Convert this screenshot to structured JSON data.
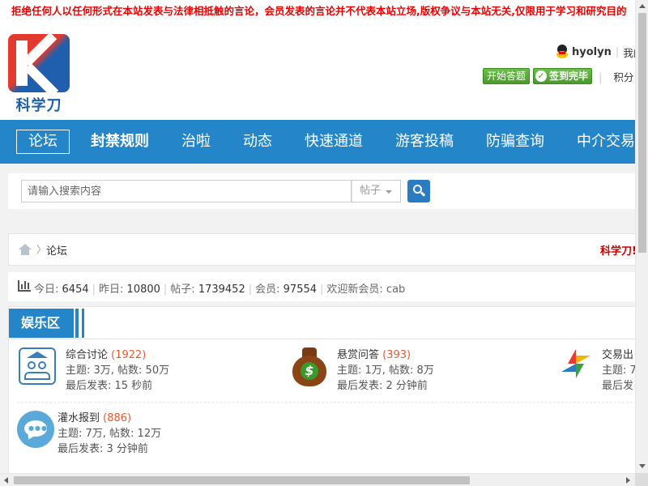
{
  "notice": "拒绝任何人以任何形式在本站发表与法律相抵触的言论，会员发表的言论并不代表本站立场,版权争议与本站无关,仅限用于学习和研究目的",
  "logo": {
    "text": "科学刀"
  },
  "user": {
    "name": "hyolyn",
    "my_link": "我的"
  },
  "header_buttons": {
    "start_quiz": "开始答题",
    "signed_in": "签到完毕",
    "points": "积分"
  },
  "nav": [
    "论坛",
    "封禁规则",
    "治啦",
    "动态",
    "快速通道",
    "游客投稿",
    "防骗查询",
    "中介交易"
  ],
  "search": {
    "placeholder": "请输入搜索内容",
    "type": "帖子"
  },
  "breadcrumb": {
    "current": "论坛",
    "right_text": "科学刀!"
  },
  "stats": {
    "today_label": "今日:",
    "today": "6454",
    "yesterday_label": "昨日:",
    "yesterday": "10800",
    "posts_label": "帖子:",
    "posts": "1739452",
    "members_label": "会员:",
    "members": "97554",
    "welcome": "欢迎新会员: cab"
  },
  "section": {
    "title": "娱乐区",
    "forums": [
      {
        "icon": "people-discussion-icon",
        "name": "综合讨论",
        "count": "(1922)",
        "stats": "主题: 3万, 帖数: 50万",
        "last": "最后发表: 15 秒前"
      },
      {
        "icon": "money-bag-icon",
        "name": "悬赏问答",
        "count": "(393)",
        "stats": "主题: 1万, 帖数: 8万",
        "last": "最后发表: 2 分钟前"
      },
      {
        "icon": "pinwheel-icon",
        "name": "交易出",
        "count": "",
        "stats": "主题: 7",
        "last": "最后发"
      },
      {
        "icon": "chat-bubble-icon",
        "name": "灌水报到",
        "count": "(886)",
        "stats": "主题: 7万, 帖数: 12万",
        "last": "最后发表: 3 分钟前"
      }
    ]
  },
  "colors": {
    "nav_bg": "#2585c9",
    "notice_text": "#ee0000",
    "count": "#e8592e",
    "signed_btn": "#4a9a2c"
  }
}
